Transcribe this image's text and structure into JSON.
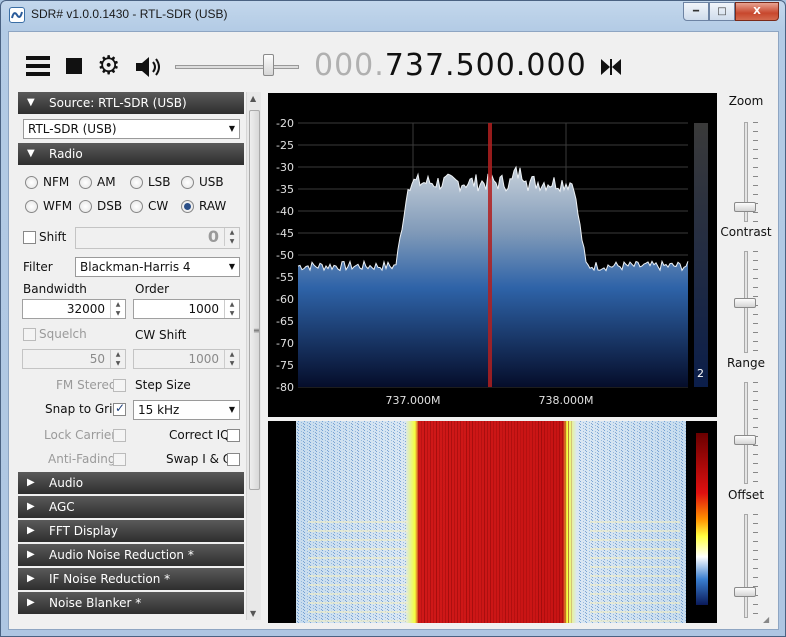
{
  "window": {
    "title": "SDR# v1.0.0.1430 - RTL-SDR (USB)",
    "controls": {
      "minimize": "━",
      "maximize": "□",
      "close": "X"
    }
  },
  "toolbar": {
    "frequency_dim": "000.",
    "frequency_bright": "737.500.000",
    "audio_gain_level": 0.72
  },
  "source": {
    "header": "Source: RTL-SDR (USB)",
    "device": "RTL-SDR (USB)"
  },
  "radio": {
    "header": "Radio",
    "modes": [
      "NFM",
      "AM",
      "LSB",
      "USB",
      "WFM",
      "DSB",
      "CW",
      "RAW"
    ],
    "selected_mode": "RAW",
    "shift_label": "Shift",
    "shift_value": "0",
    "filter_label": "Filter",
    "filter_value": "Blackman-Harris 4",
    "bandwidth_label": "Bandwidth",
    "bandwidth_value": "32000",
    "order_label": "Order",
    "order_value": "1000",
    "squelch_label": "Squelch",
    "squelch_value": "50",
    "cw_shift_label": "CW Shift",
    "cw_shift_value": "1000",
    "fm_stereo_label": "FM Stereo",
    "step_size_label": "Step Size",
    "snap_label": "Snap to Grid",
    "step_size_value": "15 kHz",
    "lock_carrier_label": "Lock Carrier",
    "correct_iq_label": "Correct IQ",
    "anti_fading_label": "Anti-Fading",
    "swap_iq_label": "Swap I & Q"
  },
  "sections": [
    "Audio",
    "AGC",
    "FFT Display",
    "Audio Noise Reduction *",
    "IF Noise Reduction *",
    "Noise Blanker *"
  ],
  "spectrum": {
    "y_ticks": [
      "-20",
      "-25",
      "-30",
      "-35",
      "-40",
      "-45",
      "-50",
      "-55",
      "-60",
      "-65",
      "-70",
      "-75",
      "-80"
    ],
    "x_ticks": [
      "737.000M",
      "738.000M"
    ],
    "meter_value": "2"
  },
  "right_sliders": {
    "zoom_label": "Zoom",
    "contrast_label": "Contrast",
    "range_label": "Range",
    "offset_label": "Offset"
  },
  "colors": {
    "panel_header": "#3a3a3a",
    "spectrum_fill_top": "#9db0c4",
    "spectrum_fill_bottom": "#0a1a3a",
    "tuned_marker": "#b02020",
    "waterfall_hot": "#d01818"
  }
}
